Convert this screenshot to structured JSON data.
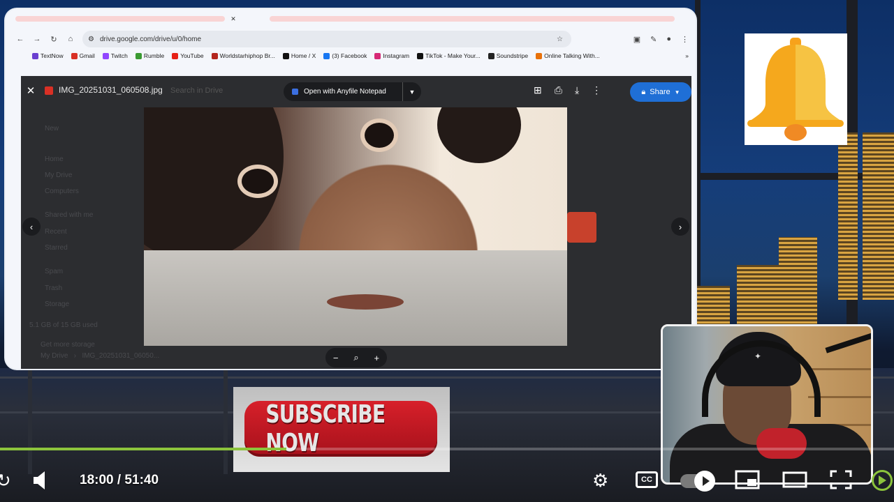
{
  "browser": {
    "url": "drive.google.com/drive/u/0/home",
    "bookmarks": [
      {
        "label": "TextNow",
        "color": "#6a3fd0"
      },
      {
        "label": "Gmail",
        "color": "#d93025"
      },
      {
        "label": "Twitch",
        "color": "#9146ff"
      },
      {
        "label": "Rumble",
        "color": "#3a9a32"
      },
      {
        "label": "YouTube",
        "color": "#e62117"
      },
      {
        "label": "Worldstarhiphop Br...",
        "color": "#b3261e"
      },
      {
        "label": "Home / X",
        "color": "#111111"
      },
      {
        "label": "(3) Facebook",
        "color": "#1877f2"
      },
      {
        "label": "Instagram",
        "color": "#d62976"
      },
      {
        "label": "TikTok - Make Your...",
        "color": "#111111"
      },
      {
        "label": "Soundstripe",
        "color": "#222222"
      },
      {
        "label": "Online Talking With...",
        "color": "#e8710a"
      }
    ]
  },
  "viewer": {
    "filename": "IMG_20251031_060508.jpg",
    "search_placeholder": "Search in Drive",
    "open_with_label": "Open with Anyfile Notepad",
    "share_label": "Share",
    "sidebar_items": [
      "New",
      "Home",
      "My Drive",
      "Computers",
      "Shared with me",
      "Recent",
      "Starred",
      "Spam",
      "Trash",
      "Storage"
    ],
    "storage_text": "5.1 GB of 15 GB used",
    "storage_button": "Get more storage",
    "breadcrumb_root": "My Drive",
    "breadcrumb_file": "IMG_20251031_06050..."
  },
  "subscribe": {
    "label": "SUBSCRIBE NOW"
  },
  "player": {
    "time": "18:00 / 51:40",
    "cc_label": "CC",
    "progress_fraction": 0.32,
    "accent": "#8cc43c"
  },
  "icons": {
    "bell": "bell-icon",
    "settings": "gear-icon",
    "volume": "volume-icon"
  }
}
